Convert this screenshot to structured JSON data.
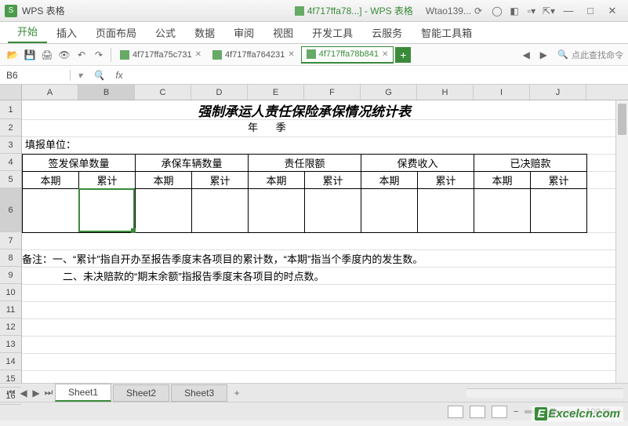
{
  "title_bar": {
    "app_name": "WPS 表格",
    "doc_label": "4f717ffa78...] - WPS 表格",
    "user_label": "Wtao139..."
  },
  "menu": [
    "开始",
    "插入",
    "页面布局",
    "公式",
    "数据",
    "审阅",
    "视图",
    "开发工具",
    "云服务",
    "智能工具箱"
  ],
  "menu_active": 0,
  "file_tabs": [
    {
      "label": "4f717ffa75c731",
      "active": false
    },
    {
      "label": "4f717ffa764231",
      "active": false
    },
    {
      "label": "4f717ffa78b841",
      "active": true
    }
  ],
  "search_placeholder": "点此查找命令",
  "formula_bar": {
    "cell": "B6",
    "fx": "fx",
    "value": ""
  },
  "columns": [
    "A",
    "B",
    "C",
    "D",
    "E",
    "F",
    "G",
    "H",
    "I",
    "J"
  ],
  "rows": [
    "1",
    "2",
    "3",
    "4",
    "5",
    "6",
    "7",
    "8",
    "9",
    "10",
    "11",
    "12",
    "13",
    "14",
    "15",
    "16"
  ],
  "doc": {
    "title": "强制承运人责任保险承保情况统计表",
    "year": "年",
    "quarter": "季",
    "filler_unit": "填报单位：",
    "unit_lbl": "单位",
    "h1": [
      "签发保单数量",
      "承保车辆数量",
      "责任限额",
      "保费收入",
      "已决赔款"
    ],
    "h2": [
      "本期",
      "累计",
      "本期",
      "累计",
      "本期",
      "累计",
      "本期",
      "累计",
      "本期",
      "累计"
    ],
    "note_label": "备注：",
    "note1": "一、“累计”指自开办至报告季度末各项目的累计数，“本期”指当个季度内的发生数。",
    "note2": "二、未决赔款的“期末余额”指报告季度末各项目的时点数。"
  },
  "sheet_tabs": [
    "Sheet1",
    "Sheet2",
    "Sheet3"
  ],
  "sheet_active": 0,
  "status": {
    "zoom": "100 %"
  },
  "watermark": "Excelcn.com"
}
